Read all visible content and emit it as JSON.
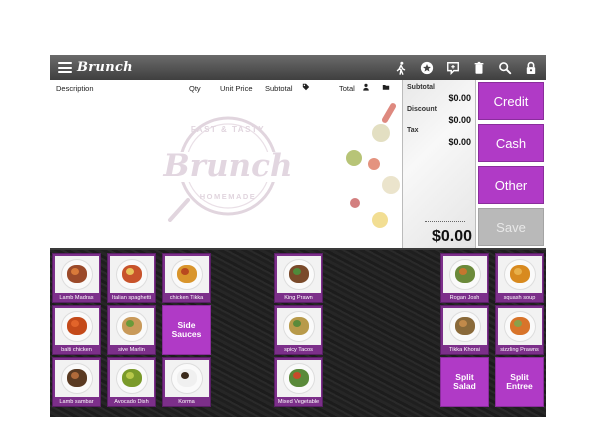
{
  "app": {
    "logo_text": "Brunch",
    "icons": [
      "menu-icon",
      "walking-person-icon",
      "star-badge-icon",
      "message-icon",
      "trash-icon",
      "search-icon",
      "lock-icon"
    ]
  },
  "order_header": {
    "description": "Description",
    "qty": "Qty",
    "unit_price": "Unit Price",
    "subtotal": "Subtotal",
    "total": "Total"
  },
  "watermark": {
    "top": "FAST & TASTY",
    "main": "Brunch",
    "bottom": "HOMEMADE"
  },
  "totals": {
    "subtotal_label": "Subtotal",
    "subtotal_value": "$0.00",
    "discount_label": "Discount",
    "discount_value": "$0.00",
    "tax_label": "Tax",
    "tax_value": "$0.00",
    "grand_total": "$0.00"
  },
  "payment": {
    "credit": "Credit",
    "cash": "Cash",
    "other": "Other",
    "save": "Save"
  },
  "products": [
    {
      "label": "Lamb Madras",
      "food": "#9b4a2a",
      "accent": "#d87a3a"
    },
    {
      "label": "Italian spaghetti",
      "food": "#c8532b",
      "accent": "#e8c15a"
    },
    {
      "label": "chicken Tikka",
      "food": "#d9952c",
      "accent": "#b8491f"
    },
    {
      "label": "King Prawn",
      "food": "#7a4a2a",
      "accent": "#4f8a3a"
    },
    {
      "label": "Rogan Josh",
      "food": "#6b8a3a",
      "accent": "#c6762e"
    },
    {
      "label": "squash soup",
      "food": "#d88a1f",
      "accent": "#e8b04a"
    },
    {
      "label": "balti chicken",
      "food": "#c44a1a",
      "accent": "#e2642a"
    },
    {
      "label": "sive Marlin",
      "food": "#c99a5a",
      "accent": "#6a9a3a"
    },
    {
      "label": "Side Sauces",
      "text": true
    },
    {
      "label": "spicy Tacos",
      "food": "#b89a4a",
      "accent": "#5a8a3a"
    },
    {
      "label": "Tikka Khorai",
      "food": "#8a6a3a",
      "accent": "#c28a4a"
    },
    {
      "label": "sizzling Prawns",
      "food": "#d8742a",
      "accent": "#8aa04a"
    },
    {
      "label": "Lamb sambar",
      "food": "#5a3a22",
      "accent": "#b06a3a"
    },
    {
      "label": "Avocado Dish",
      "food": "#7a9a2a",
      "accent": "#b8c84a"
    },
    {
      "label": "Korma",
      "food": "#f0f0f0",
      "accent": "#3a2a1a"
    },
    {
      "label": "Mixed Vegetable",
      "food": "#5a8a3a",
      "accent": "#c84a2a"
    },
    {
      "label": "Split Salad",
      "text": true
    },
    {
      "label": "Split Entree",
      "text": true
    }
  ],
  "colors": {
    "accent": "#b03ac6",
    "tile_border": "#7c2f8a",
    "topbar": "#4a4a4a"
  }
}
